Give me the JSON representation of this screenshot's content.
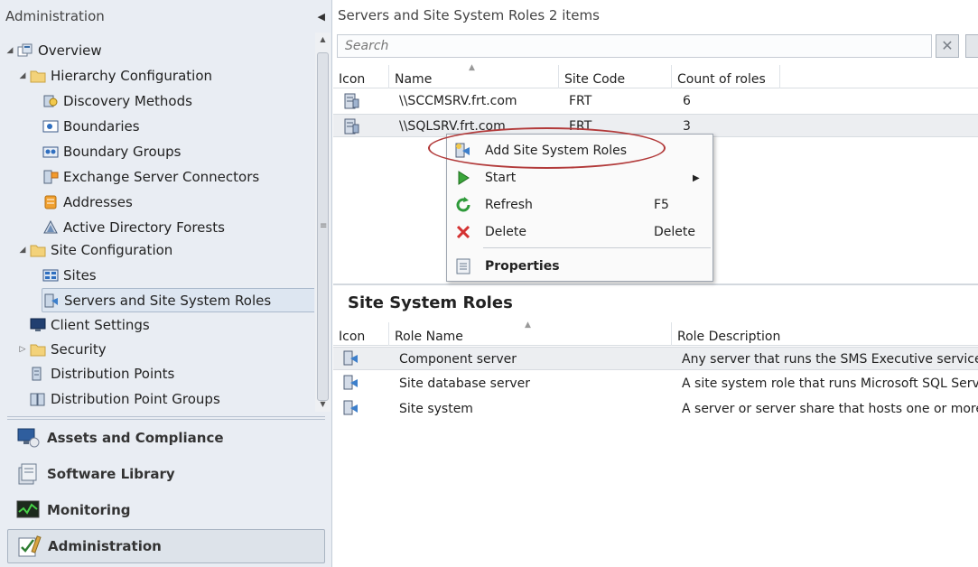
{
  "nav": {
    "title": "Administration",
    "tree": [
      {
        "label": "Overview",
        "icon": "overview-icon",
        "expander": "expanded"
      },
      {
        "label": "Hierarchy Configuration",
        "icon": "folder-icon",
        "expander": "expanded"
      },
      {
        "label": "Discovery Methods",
        "icon": "discovery-icon"
      },
      {
        "label": "Boundaries",
        "icon": "boundaries-icon"
      },
      {
        "label": "Boundary Groups",
        "icon": "boundary-groups-icon"
      },
      {
        "label": "Exchange Server Connectors",
        "icon": "exchange-icon"
      },
      {
        "label": "Addresses",
        "icon": "addresses-icon"
      },
      {
        "label": "Active Directory Forests",
        "icon": "forest-icon"
      },
      {
        "label": "Site Configuration",
        "icon": "folder-icon",
        "expander": "expanded"
      },
      {
        "label": "Sites",
        "icon": "sites-icon"
      },
      {
        "label": "Servers and Site System Roles",
        "icon": "server-roles-icon",
        "selected": true
      },
      {
        "label": "Client Settings",
        "icon": "client-settings-icon"
      },
      {
        "label": "Security",
        "icon": "folder-icon",
        "expander": "collapsed"
      },
      {
        "label": "Distribution Points",
        "icon": "distribution-points-icon"
      },
      {
        "label": "Distribution Point Groups",
        "icon": "distribution-point-groups-icon"
      }
    ],
    "workspaces": [
      {
        "label": "Assets and Compliance",
        "icon": "assets-icon"
      },
      {
        "label": "Software Library",
        "icon": "software-library-icon"
      },
      {
        "label": "Monitoring",
        "icon": "monitoring-icon"
      },
      {
        "label": "Administration",
        "icon": "administration-icon",
        "active": true
      }
    ]
  },
  "main": {
    "title": "Servers and Site System Roles 2 items",
    "search_placeholder": "Search",
    "clear_glyph": "✕",
    "columns": [
      "Icon",
      "Name",
      "Site Code",
      "Count of roles"
    ],
    "rows": [
      {
        "name": "\\\\SCCMSRV.frt.com",
        "site_code": "FRT",
        "count": "6"
      },
      {
        "name": "\\\\SQLSRV.frt.com",
        "site_code": "FRT",
        "count": "3"
      }
    ]
  },
  "context_menu": {
    "items": [
      {
        "label": "Add Site System Roles",
        "icon": "add-roles-icon"
      },
      {
        "label": "Start",
        "icon": "start-icon",
        "submenu": "▶"
      },
      {
        "label": "Refresh",
        "icon": "refresh-icon",
        "shortcut": "F5"
      },
      {
        "label": "Delete",
        "icon": "delete-icon",
        "shortcut": "Delete"
      },
      {
        "label": "Properties",
        "icon": "properties-icon"
      }
    ]
  },
  "details": {
    "title": "Site System Roles",
    "columns": [
      "Icon",
      "Role Name",
      "Role Description"
    ],
    "rows": [
      {
        "name": "Component server",
        "description": "Any server that runs the SMS Executive service."
      },
      {
        "name": "Site database server",
        "description": "A site system role that runs Microsoft SQL Server"
      },
      {
        "name": "Site system",
        "description": "A server or server share that hosts one or more s"
      }
    ]
  },
  "colors": {
    "highlight": "#b23a3a",
    "nav_bg": "#e9edf3",
    "selection": "#dde6f1"
  }
}
